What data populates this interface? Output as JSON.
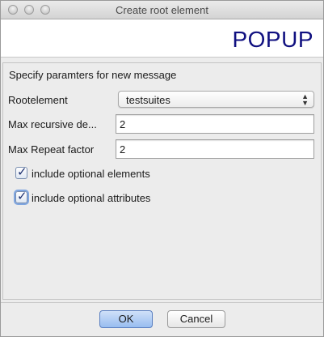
{
  "window": {
    "title": "Create root element"
  },
  "banner": {
    "text": "POPUP",
    "color": "#101080"
  },
  "form": {
    "section_title": "Specify paramters for new message",
    "rootelement": {
      "label": "Rootelement",
      "selected": "testsuites"
    },
    "max_recursive": {
      "label": "Max recursive de...",
      "value": "2"
    },
    "max_repeat": {
      "label": "Max Repeat factor",
      "value": "2"
    },
    "optional_elements": {
      "label": "include optional elements",
      "checked": true
    },
    "optional_attributes": {
      "label": "include optional attributes",
      "checked": true
    }
  },
  "buttons": {
    "ok_label": "OK",
    "cancel_label": "Cancel"
  },
  "icons": {
    "select": "up-down-chevron-icon",
    "check": "checkmark-icon"
  }
}
